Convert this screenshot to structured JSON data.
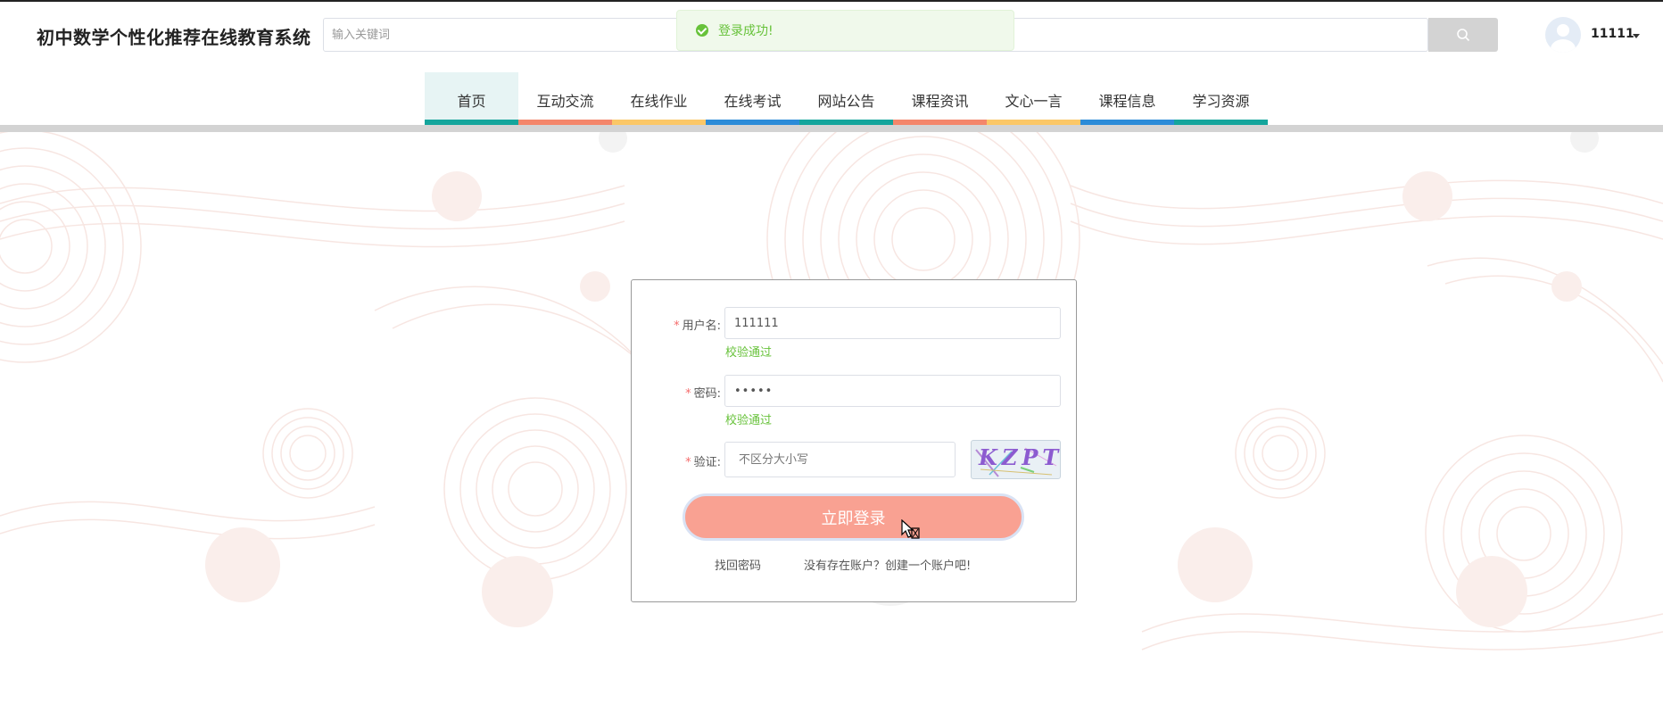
{
  "header": {
    "site_title": "初中数学个性化推荐在线教育系统",
    "search_placeholder": "输入关键词",
    "user_name": "11111"
  },
  "nav": {
    "items": [
      {
        "label": "首页",
        "color": "#14a59c",
        "active": true
      },
      {
        "label": "互动交流",
        "color": "#f4866b"
      },
      {
        "label": "在线作业",
        "color": "#fbc767"
      },
      {
        "label": "在线考试",
        "color": "#2b8bd8"
      },
      {
        "label": "网站公告",
        "color": "#14a59c"
      },
      {
        "label": "课程资讯",
        "color": "#f4866b"
      },
      {
        "label": "文心一言",
        "color": "#fbc767"
      },
      {
        "label": "课程信息",
        "color": "#2b8bd8"
      },
      {
        "label": "学习资源",
        "color": "#14a59c"
      }
    ]
  },
  "toast": {
    "message": "登录成功!"
  },
  "login": {
    "username_label": "用户名:",
    "username_value": "111111",
    "username_status": "校验通过",
    "password_label": "密码:",
    "password_value": "•••••",
    "password_status": "校验通过",
    "captcha_label": "验证:",
    "captcha_placeholder": "不区分大小写",
    "captcha_text": "KZPT",
    "submit_label": "立即登录",
    "forgot_password": "找回密码",
    "register_link": "没有存在账户？创建一个账户吧!"
  },
  "colors": {
    "accent_button": "#f9a192",
    "success": "#67c23a",
    "required": "#f56c6c"
  }
}
